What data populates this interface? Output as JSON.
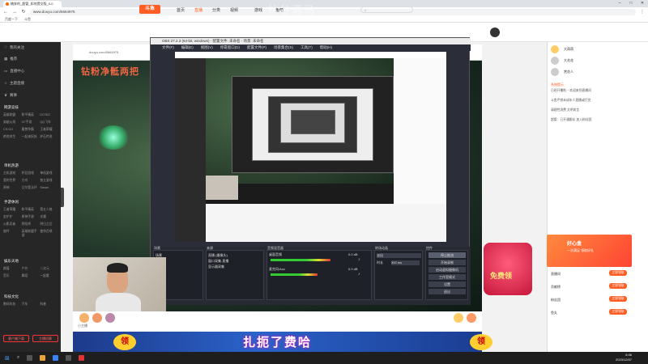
{
  "browser": {
    "tab_title": "楠奔的_超管_如何提交版_5-0",
    "url": "www.douyu.com/5664975",
    "bookmarks": [
      "百度一下",
      "斗鱼"
    ]
  },
  "watermark": "林谷酒马",
  "douyu": {
    "logo": "斗鱼",
    "nav": [
      "首页",
      "直播",
      "分类",
      "视频",
      "游戏",
      "鱼吧"
    ],
    "active_nav": 1
  },
  "sidebar": {
    "top_items": [
      "我的关注",
      "推荐",
      "直播中心",
      "主题直播",
      "赛事"
    ],
    "sections": [
      {
        "title": "网游竞技",
        "more": "全部",
        "items": [
          "英雄联盟",
          "和平精英",
          "DOTA2",
          "穿越火线",
          "CF手游",
          "QQ飞车",
          "CS:GO",
          "魔兽争霸",
          "王者荣耀",
          "绝地求生",
          "一起来捉妖",
          "炉石传说"
        ]
      },
      {
        "title": "单机热游",
        "more": "全部",
        "items": [
          "主机游戏",
          "怀旧游戏",
          "单机游戏",
          "我的世界",
          "方舟",
          "独立游戏",
          "原神",
          "艾尔登法环",
          "Steam"
        ]
      },
      {
        "title": "手游休闲",
        "more": "全部",
        "items": [
          "王者荣耀",
          "和平精英",
          "第五人格",
          "金铲铲",
          "原神手游",
          "光遇",
          "火影忍者",
          "阴阳师",
          "明日之后",
          "崩坏",
          "英雄联盟手游",
          "使命召唤"
        ]
      },
      {
        "title": "娱乐天地",
        "more": "全部",
        "items": [
          "颜值",
          "户外",
          "二次元",
          "音乐",
          "舞蹈",
          "一起看"
        ]
      },
      {
        "title": "科技文化",
        "more": "全部",
        "items": [
          "数码科技",
          "汽车",
          "科普"
        ]
      }
    ],
    "bottom_buttons": [
      "客户端下载",
      "主播招募"
    ]
  },
  "stream": {
    "title": "钻粉净骶两把",
    "inner_url": "douyu.com/5664975"
  },
  "obs": {
    "title": "OBS 27.2.3 (64-bit, windows) - 配置文件: 未命名 - 场景: 未命名",
    "menu": [
      "文件(F)",
      "编辑(E)",
      "视图(V)",
      "停靠窗口(D)",
      "配置文件(P)",
      "场景集合(S)",
      "工具(T)",
      "帮助(H)"
    ],
    "docks": {
      "scenes": {
        "header": "场景",
        "items": [
          "场景"
        ]
      },
      "sources": {
        "header": "来源",
        "items": [
          "直播 (摄像头)",
          "窗口采集-直播",
          "显示器采集"
        ]
      },
      "mixer": {
        "header": "音频混音器",
        "items": [
          {
            "name": "桌面音频",
            "db": "0.0 dB",
            "level": 0.62
          },
          {
            "name": "麦克风/Aux",
            "db": "0.0 dB",
            "level": 0.48
          }
        ]
      },
      "transitions": {
        "header": "转场动画",
        "type": "淡出",
        "duration_label": "时长",
        "duration": "300 ms"
      },
      "controls": {
        "header": "控件",
        "items": [
          "停止推流",
          "开始录制",
          "启动虚拟摄像机",
          "工作室模式",
          "设置",
          "退出"
        ]
      }
    }
  },
  "player": {
    "bottom_tag": "小主播",
    "gift_banner": "扎扼了费哈",
    "ling": "领"
  },
  "right": {
    "top_users": [
      "大萌萌",
      "大花花",
      "赏花人"
    ],
    "notice_name": "系统提示",
    "chat": [
      "已经开播啦 ~ 欢迎来到直播间",
      "斗鱼严禁未成年人直播或打赏",
      "请理性消费 文明发言",
      "超管：已开通舰队 加入粉丝团"
    ],
    "gift_box_title": "好心盒",
    "gift_box_sub": "一次满足 领取好礼",
    "free_box": "免费领",
    "rows": [
      {
        "label": "直播间",
        "btn": "立即领取"
      },
      {
        "label": "贡献榜",
        "btn": "立即领取"
      },
      {
        "label": "粉丝团",
        "btn": "立即领取"
      },
      {
        "label": "鱼丸",
        "btn": "立即领取"
      }
    ]
  },
  "taskbar": {
    "time": "6:06",
    "date": "2023/12/07"
  }
}
